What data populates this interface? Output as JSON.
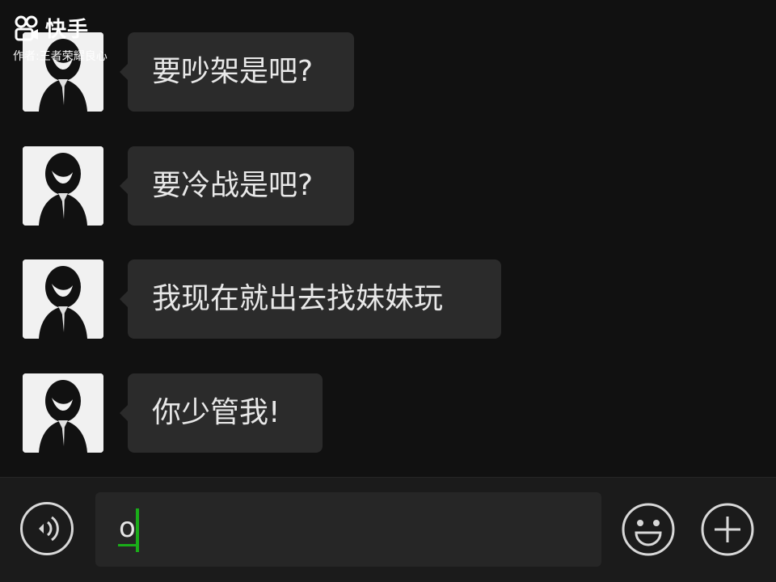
{
  "watermark": {
    "brand": "快手",
    "author": "作者:王者荣耀良心"
  },
  "messages": [
    {
      "text": "要吵架是吧?"
    },
    {
      "text": "要冷战是吧?"
    },
    {
      "text": "我现在就出去找妹妹玩"
    },
    {
      "text": "你少管我!"
    }
  ],
  "composer": {
    "input_value": "o"
  },
  "icons": {
    "voice": "voice-icon",
    "emoji": "emoji-icon",
    "plus": "plus-icon",
    "logo": "kuaishou-logo-icon"
  },
  "colors": {
    "background": "#111111",
    "bubble": "#2b2b2b",
    "text": "#e8e8e8",
    "accent": "#1aad19"
  }
}
